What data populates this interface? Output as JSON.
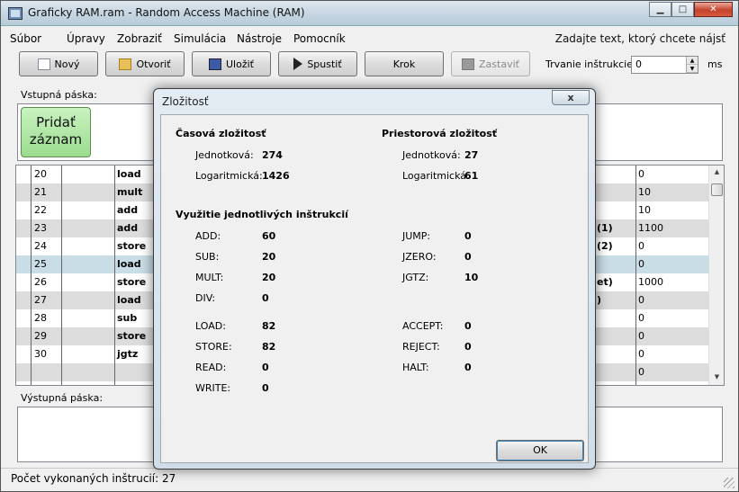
{
  "window": {
    "title": "Graficky RAM.ram - Random Access Machine (RAM)"
  },
  "menu": {
    "items": [
      "Súbor",
      "Úpravy",
      "Zobraziť",
      "Simulácia",
      "Nástroje",
      "Pomocník"
    ],
    "search_hint": "Zadajte text, ktorý chcete nájsť"
  },
  "toolbar": {
    "new": "Nový",
    "open": "Otvoriť",
    "save": "Uložiť",
    "run": "Spustiť",
    "step": "Krok",
    "stop": "Zastaviť",
    "duration_label": "Trvanie inštrukcie:",
    "duration_value": "0",
    "unit": "ms"
  },
  "input_tape": {
    "label": "Vstupná páska:",
    "add_record": "Pridať záznam"
  },
  "grid": {
    "rows": [
      {
        "num": "20",
        "op": "load",
        "arg": "",
        "val": "0"
      },
      {
        "num": "21",
        "op": "mult",
        "arg": "",
        "val": "10"
      },
      {
        "num": "22",
        "op": "add",
        "arg": "",
        "val": "10"
      },
      {
        "num": "23",
        "op": "add",
        "arg": "(1)",
        "val": "1100"
      },
      {
        "num": "24",
        "op": "store",
        "arg": "(2)",
        "val": "0"
      },
      {
        "num": "25",
        "op": "load",
        "arg": "",
        "val": "0"
      },
      {
        "num": "26",
        "op": "store",
        "arg": "et)",
        "val": "1000"
      },
      {
        "num": "27",
        "op": "load",
        "arg": ")",
        "val": "0"
      },
      {
        "num": "28",
        "op": "sub",
        "arg": "",
        "val": "0"
      },
      {
        "num": "29",
        "op": "store",
        "arg": "",
        "val": "0"
      },
      {
        "num": "30",
        "op": "jgtz",
        "arg": "",
        "val": "0"
      },
      {
        "num": "",
        "op": "",
        "arg": "",
        "val": "0"
      }
    ]
  },
  "output_tape": {
    "label": "Výstupná páska:"
  },
  "status": {
    "text": "Počet vykonaných inštrucií: 27"
  },
  "dialog": {
    "title": "Zložitosť",
    "close": "x",
    "time_heading": "Časová zložitosť",
    "space_heading": "Priestorová zložitosť",
    "unit_label": "Jednotková:",
    "log_label": "Logaritmická:",
    "time_unit": "274",
    "time_log": "1426",
    "space_unit": "27",
    "space_log": "61",
    "usage_heading": "Využitie jednotlivých inštrukcií",
    "left_instr": [
      {
        "name": "ADD:",
        "value": "60"
      },
      {
        "name": "SUB:",
        "value": "20"
      },
      {
        "name": "MULT:",
        "value": "20"
      },
      {
        "name": "DIV:",
        "value": "0"
      },
      {
        "name": "LOAD:",
        "value": "82"
      },
      {
        "name": "STORE:",
        "value": "82"
      },
      {
        "name": "READ:",
        "value": "0"
      },
      {
        "name": "WRITE:",
        "value": "0"
      }
    ],
    "right_instr": [
      {
        "name": "JUMP:",
        "value": "0"
      },
      {
        "name": "JZERO:",
        "value": "0"
      },
      {
        "name": "JGTZ:",
        "value": "10"
      },
      {
        "name": "ACCEPT:",
        "value": "0"
      },
      {
        "name": "REJECT:",
        "value": "0"
      },
      {
        "name": "HALT:",
        "value": "0"
      }
    ],
    "ok": "OK"
  }
}
